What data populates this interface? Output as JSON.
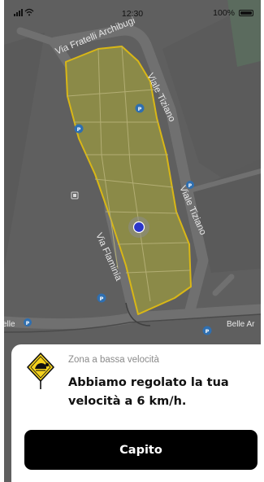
{
  "status_bar": {
    "time": "12:30",
    "battery_percent": "100%"
  },
  "map": {
    "streets": {
      "via_fratelli_archibugi": "Via Fratelli Archibugi",
      "viale_tiziano_upper": "Viale Tiziano",
      "viale_tiziano_lower": "Viale Tiziano",
      "via_flaminia": "Via Flaminia",
      "edge_left": "elle",
      "edge_right": "Belle Ar"
    },
    "zone_colors": {
      "fill": "#8b8a48",
      "border": "#d9b716",
      "location": "#2b36c9"
    }
  },
  "sheet": {
    "label": "Zona a bassa velocità",
    "title": "Abbiamo regolato la tua velocità a 6 km/h.",
    "button_label": "Capito"
  }
}
